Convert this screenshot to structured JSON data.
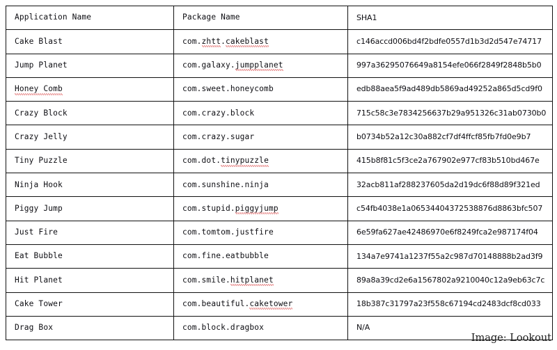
{
  "table": {
    "columns": [
      "Application Name",
      "Package Name",
      "SHA1"
    ],
    "rows": [
      {
        "app": "Cake Blast",
        "app_misspelled": [],
        "package": "com.zhtt.cakeblast",
        "package_misspelled": [
          "zhtt",
          "cakeblast"
        ],
        "sha1": "c146accd006bd4f2bdfe0557d1b3d2d547e74717"
      },
      {
        "app": "Jump Planet",
        "app_misspelled": [],
        "package": "com.galaxy.jumpplanet",
        "package_misspelled": [
          "jumpplanet"
        ],
        "sha1": "997a36295076649a8154efe066f2849f2848b5b0"
      },
      {
        "app": "Honey Comb",
        "app_misspelled": [
          "Honey Comb"
        ],
        "package": "com.sweet.honeycomb",
        "package_misspelled": [],
        "sha1": "edb88aea5f9ad489db5869ad49252a865d5cd9f0"
      },
      {
        "app": "Crazy Block",
        "app_misspelled": [],
        "package": "com.crazy.block",
        "package_misspelled": [],
        "sha1": "715c58c3e7834256637b29a951326c31ab0730b0"
      },
      {
        "app": "Crazy Jelly",
        "app_misspelled": [],
        "package": "com.crazy.sugar",
        "package_misspelled": [],
        "sha1": "b0734b52a12c30a882cf7df4ffcf85fb7fd0e9b7"
      },
      {
        "app": "Tiny Puzzle",
        "app_misspelled": [],
        "package": "com.dot.tinypuzzle",
        "package_misspelled": [
          "tinypuzzle"
        ],
        "sha1": "415b8f81c5f3ce2a767902e977cf83b510bd467e"
      },
      {
        "app": "Ninja Hook",
        "app_misspelled": [],
        "package": "com.sunshine.ninja",
        "package_misspelled": [],
        "sha1": "32acb811af288237605da2d19dc6f88d89f321ed"
      },
      {
        "app": "Piggy Jump",
        "app_misspelled": [],
        "package": "com.stupid.piggyjump",
        "package_misspelled": [
          "piggyjump"
        ],
        "sha1": "c54fb4038e1a06534404372538876d8863bfc507"
      },
      {
        "app": "Just Fire",
        "app_misspelled": [],
        "package": "com.tomtom.justfire",
        "package_misspelled": [],
        "sha1": "6e59fa627ae42486970e6f8249fca2e987174f04"
      },
      {
        "app": "Eat Bubble",
        "app_misspelled": [],
        "package": "com.fine.eatbubble",
        "package_misspelled": [],
        "sha1": "134a7e9741a1237f55a2c987d70148888b2ad3f9"
      },
      {
        "app": "Hit Planet",
        "app_misspelled": [],
        "package": "com.smile.hitplanet",
        "package_misspelled": [
          "hitplanet"
        ],
        "sha1": "89a8a39cd2e6a1567802a9210040c12a9eb63c7c"
      },
      {
        "app": "Cake Tower",
        "app_misspelled": [],
        "package": "com.beautiful.caketower",
        "package_misspelled": [
          "caketower"
        ],
        "sha1": "18b387c31797a23f558c67194cd2483dcf8cd033"
      },
      {
        "app": "Drag Box",
        "app_misspelled": [],
        "package": "com.block.dragbox",
        "package_misspelled": [],
        "sha1": "N/A"
      }
    ]
  },
  "caption": "Image: Lookout",
  "colors": {
    "border": "#111111",
    "text": "#0d0d12",
    "spellcheck_underline": "#d42a2a",
    "background": "#ffffff"
  }
}
